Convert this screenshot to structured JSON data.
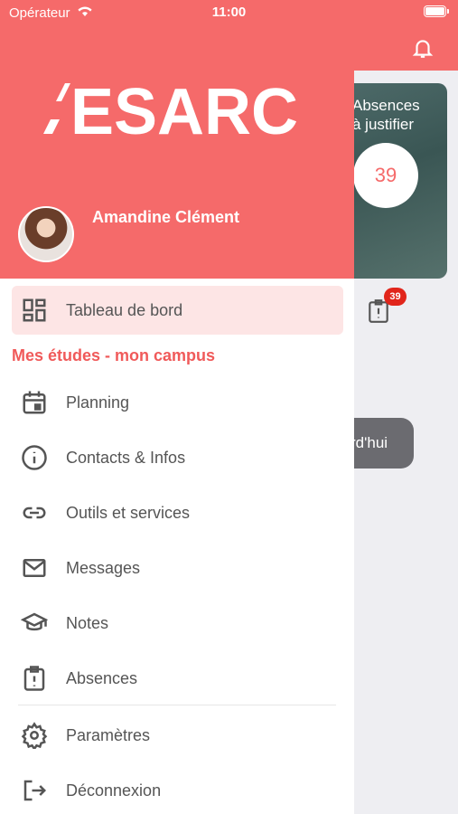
{
  "status_bar": {
    "carrier": "Opérateur",
    "time": "11:00"
  },
  "background": {
    "card_text": "Absences\nà justifier",
    "card_value": "39",
    "badge_count": "39",
    "pill_text": "rd'hui"
  },
  "drawer": {
    "logo": "ESARC",
    "user_name": "Amandine Clément",
    "dashboard_label": "Tableau de bord",
    "section_title": "Mes études - mon campus",
    "items": [
      {
        "label": "Planning",
        "icon": "calendar-icon"
      },
      {
        "label": "Contacts & Infos",
        "icon": "info-icon"
      },
      {
        "label": "Outils et services",
        "icon": "link-icon"
      },
      {
        "label": "Messages",
        "icon": "mail-icon"
      },
      {
        "label": "Notes",
        "icon": "graduation-cap-icon"
      },
      {
        "label": "Absences",
        "icon": "alert-clipboard-icon"
      }
    ],
    "bottom_items": [
      {
        "label": "Paramètres",
        "icon": "gear-icon"
      },
      {
        "label": "Déconnexion",
        "icon": "logout-icon"
      }
    ]
  },
  "colors": {
    "brand": "#f56a6a",
    "section": "#f05a5a",
    "active_bg": "#fde5e5",
    "badge": "#e1251b"
  }
}
